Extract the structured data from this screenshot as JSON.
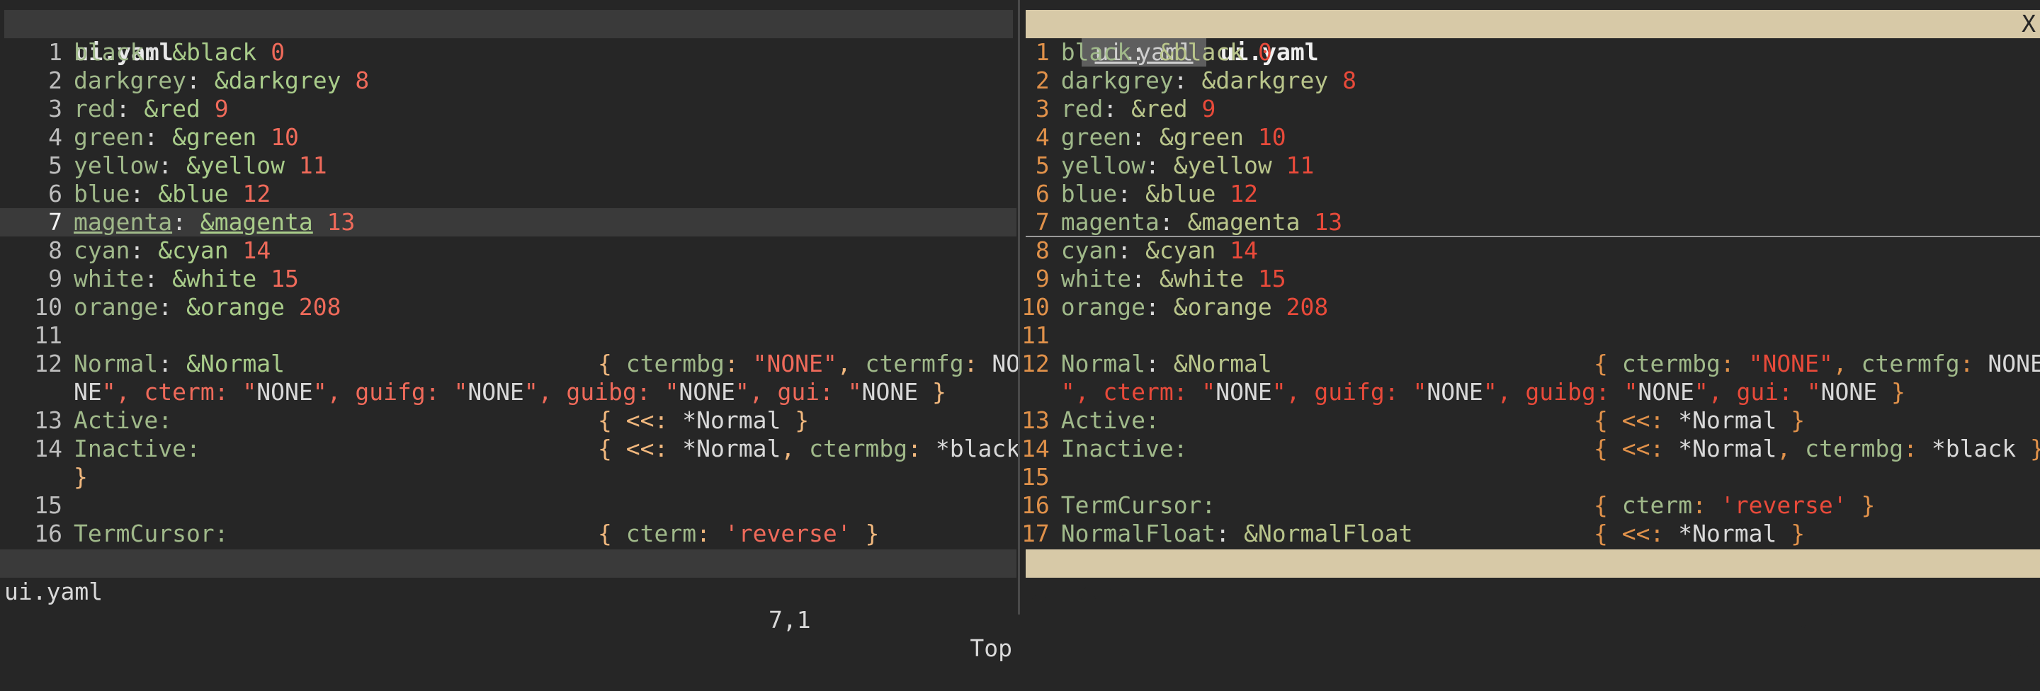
{
  "left": {
    "tab_label": "ui.yaml",
    "lines": [
      {
        "num": "1",
        "key": "black",
        "anchor": "&black",
        "value": "0"
      },
      {
        "num": "2",
        "key": "darkgrey",
        "anchor": "&darkgrey",
        "value": "8"
      },
      {
        "num": "3",
        "key": "red",
        "anchor": "&red",
        "value": "9"
      },
      {
        "num": "4",
        "key": "green",
        "anchor": "&green",
        "value": "10"
      },
      {
        "num": "5",
        "key": "yellow",
        "anchor": "&yellow",
        "value": "11"
      },
      {
        "num": "6",
        "key": "blue",
        "anchor": "&blue",
        "value": "12"
      },
      {
        "num": "7",
        "key": "magenta",
        "anchor": "&magenta",
        "value": "13"
      },
      {
        "num": "8",
        "key": "cyan",
        "anchor": "&cyan",
        "value": "14"
      },
      {
        "num": "9",
        "key": "white",
        "anchor": "&white",
        "value": "15"
      },
      {
        "num": "10",
        "key": "orange",
        "anchor": "&orange",
        "value": "208"
      },
      {
        "num": "11"
      },
      {
        "num": "12",
        "text1": "Normal: &Normal",
        "text2": "{ ctermbg: \"NONE\", ctermfg: \"NO"
      },
      {
        "num": "",
        "wrap": "NE\", cterm: \"NONE\", guifg: \"NONE\", guibg: \"NONE\", gui: \"NONE\" }"
      },
      {
        "num": "13",
        "text1": "Active:",
        "text2": "{ <<: *Normal }"
      },
      {
        "num": "14",
        "text1": "Inactive:",
        "text2": "{ <<: *Normal, ctermbg: *black"
      },
      {
        "num": "",
        "wrap": "}"
      },
      {
        "num": "15"
      },
      {
        "num": "16",
        "text1": "TermCursor:",
        "text2": "{ cterm: 'reverse' }"
      }
    ],
    "status": {
      "file": "ui.yaml",
      "pos": "7,1",
      "scroll": "Top"
    }
  },
  "right": {
    "tabs": [
      {
        "label": "ui.yaml",
        "active": false
      },
      {
        "label": "ui.yaml",
        "active": true
      }
    ],
    "close_label": "X",
    "lines": [
      {
        "num": "1",
        "key": "black",
        "anchor": "&black",
        "value": "0"
      },
      {
        "num": "2",
        "key": "darkgrey",
        "anchor": "&darkgrey",
        "value": "8"
      },
      {
        "num": "3",
        "key": "red",
        "anchor": "&red",
        "value": "9"
      },
      {
        "num": "4",
        "key": "green",
        "anchor": "&green",
        "value": "10"
      },
      {
        "num": "5",
        "key": "yellow",
        "anchor": "&yellow",
        "value": "11"
      },
      {
        "num": "6",
        "key": "blue",
        "anchor": "&blue",
        "value": "12"
      },
      {
        "num": "7",
        "key": "magenta",
        "anchor": "&magenta",
        "value": "13"
      },
      {
        "num": "8",
        "key": "cyan",
        "anchor": "&cyan",
        "value": "14"
      },
      {
        "num": "9",
        "key": "white",
        "anchor": "&white",
        "value": "15"
      },
      {
        "num": "10",
        "key": "orange",
        "anchor": "&orange",
        "value": "208"
      },
      {
        "num": "11"
      },
      {
        "num": "12",
        "text1": "Normal: &Normal",
        "text2": "{ ctermbg: \"NONE\", ctermfg: \"NONE"
      },
      {
        "num": "",
        "wrap": "\", cterm: \"NONE\", guifg: \"NONE\", guibg: \"NONE\", gui: \"NONE\" }"
      },
      {
        "num": "13",
        "text1": "Active:",
        "text2": "{ <<: *Normal }"
      },
      {
        "num": "14",
        "text1": "Inactive:",
        "text2": "{ <<: *Normal, ctermbg: *black }"
      },
      {
        "num": "15"
      },
      {
        "num": "16",
        "text1": "TermCursor:",
        "text2": "{ cterm: 'reverse' }"
      },
      {
        "num": "17",
        "text1": "NormalFloat: &NormalFloat",
        "text2": "{ <<: *Normal }"
      }
    ],
    "status": {
      "file": "ui.yaml",
      "pos": "7,1",
      "scroll": "Top"
    }
  }
}
